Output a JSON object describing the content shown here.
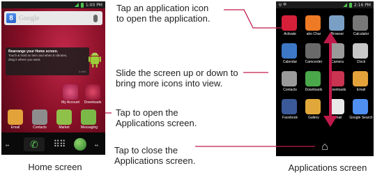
{
  "home_screen": {
    "status_time": "1:00 PM",
    "search_word": "Google",
    "tip_title": "Rearrange your Home screen.",
    "tip_body": "Touch & hold an item and when it vibrates, drag it where you want.",
    "tip_page": "1 of 6",
    "apps": [
      {
        "label": "My Account",
        "color": "#d43a6a"
      },
      {
        "label": "Downloads",
        "color": "#c93450"
      },
      {
        "label": "Email",
        "color": "#e3a23a"
      },
      {
        "label": "Contacts",
        "color": "#8d8d8d"
      },
      {
        "label": "Market",
        "color": "#8fc04a"
      },
      {
        "label": "Messaging",
        "color": "#7ab848"
      }
    ]
  },
  "apps_screen": {
    "status_time": "2:16 PM",
    "apps": [
      {
        "label": "Activate",
        "color": "#d6203a"
      },
      {
        "label": "alro Char",
        "color": "#ee7a25"
      },
      {
        "label": "Browser",
        "color": "#7a9fc4"
      },
      {
        "label": "Calculator",
        "color": "#777777"
      },
      {
        "label": "Calendar",
        "color": "#3d78c6"
      },
      {
        "label": "Camcorder",
        "color": "#6a6a6a"
      },
      {
        "label": "Camera",
        "color": "#9a9a9a"
      },
      {
        "label": "Clock",
        "color": "#c7c7c7"
      },
      {
        "label": "Contacts",
        "color": "#9a9a9a"
      },
      {
        "label": "Downloads",
        "color": "#4aa84a"
      },
      {
        "label": "Downloads",
        "color": "#c93450"
      },
      {
        "label": "Email",
        "color": "#e3a23a"
      },
      {
        "label": "Facebook",
        "color": "#3b5998"
      },
      {
        "label": "Gallery",
        "color": "#e0a83a"
      },
      {
        "label": "Gmail",
        "color": "#e8e8e8"
      },
      {
        "label": "Google Search",
        "color": "#4f8ff0"
      }
    ]
  },
  "captions": {
    "tap_app_icon": "Tap an application icon\nto open the application.",
    "slide_screen": "Slide the screen up or down to\nbring more icons into view.",
    "tap_open_apps": "Tap to open the\nApplications screen.",
    "tap_close_apps": "Tap to close the\nApplications screen."
  },
  "labels": {
    "home_screen": "Home screen",
    "applications_screen": "Applications screen"
  },
  "colors": {
    "callout_line": "#c01a4a",
    "arrow": "#c01a4a"
  }
}
